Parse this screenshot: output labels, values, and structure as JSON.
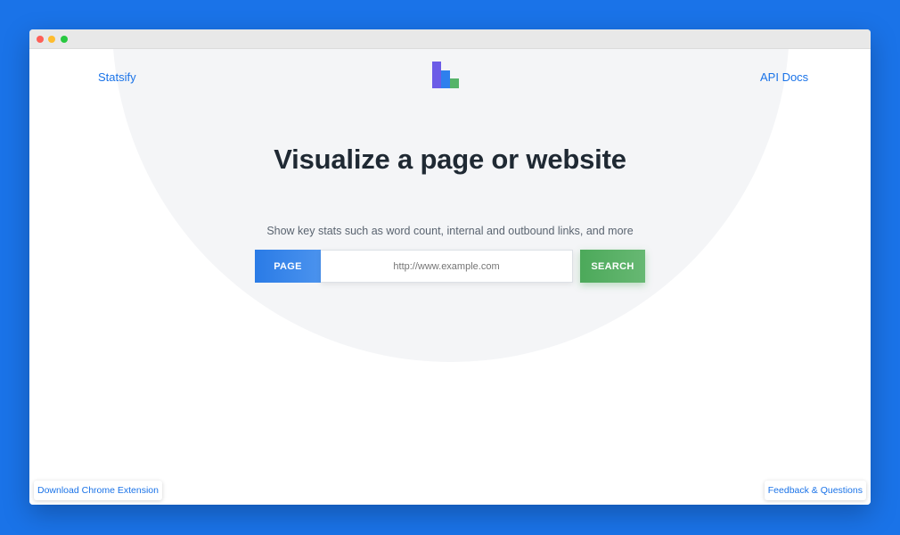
{
  "colors": {
    "background": "#1a73e8",
    "accent": "#1a73e8",
    "page_button": "#2a7be6",
    "search_button": "#4ca95a",
    "logo_bars": [
      "#6c5ce7",
      "#2f80ed",
      "#56b46a"
    ]
  },
  "window": {
    "traffic_lights": [
      "#fe5f57",
      "#febc2e",
      "#28c840"
    ]
  },
  "nav": {
    "brand_label": "Statsify",
    "api_docs_label": "API Docs",
    "logo_icon": "bar-chart-logo-icon"
  },
  "hero": {
    "title": "Visualize a page or website",
    "subtitle": "Show key stats such as word count, internal and outbound links, and more"
  },
  "search": {
    "type_label": "PAGE",
    "placeholder": "http://www.example.com",
    "value": "",
    "button_label": "SEARCH"
  },
  "footer": {
    "chrome_extension_label": "Download Chrome Extension",
    "feedback_label": "Feedback & Questions"
  }
}
